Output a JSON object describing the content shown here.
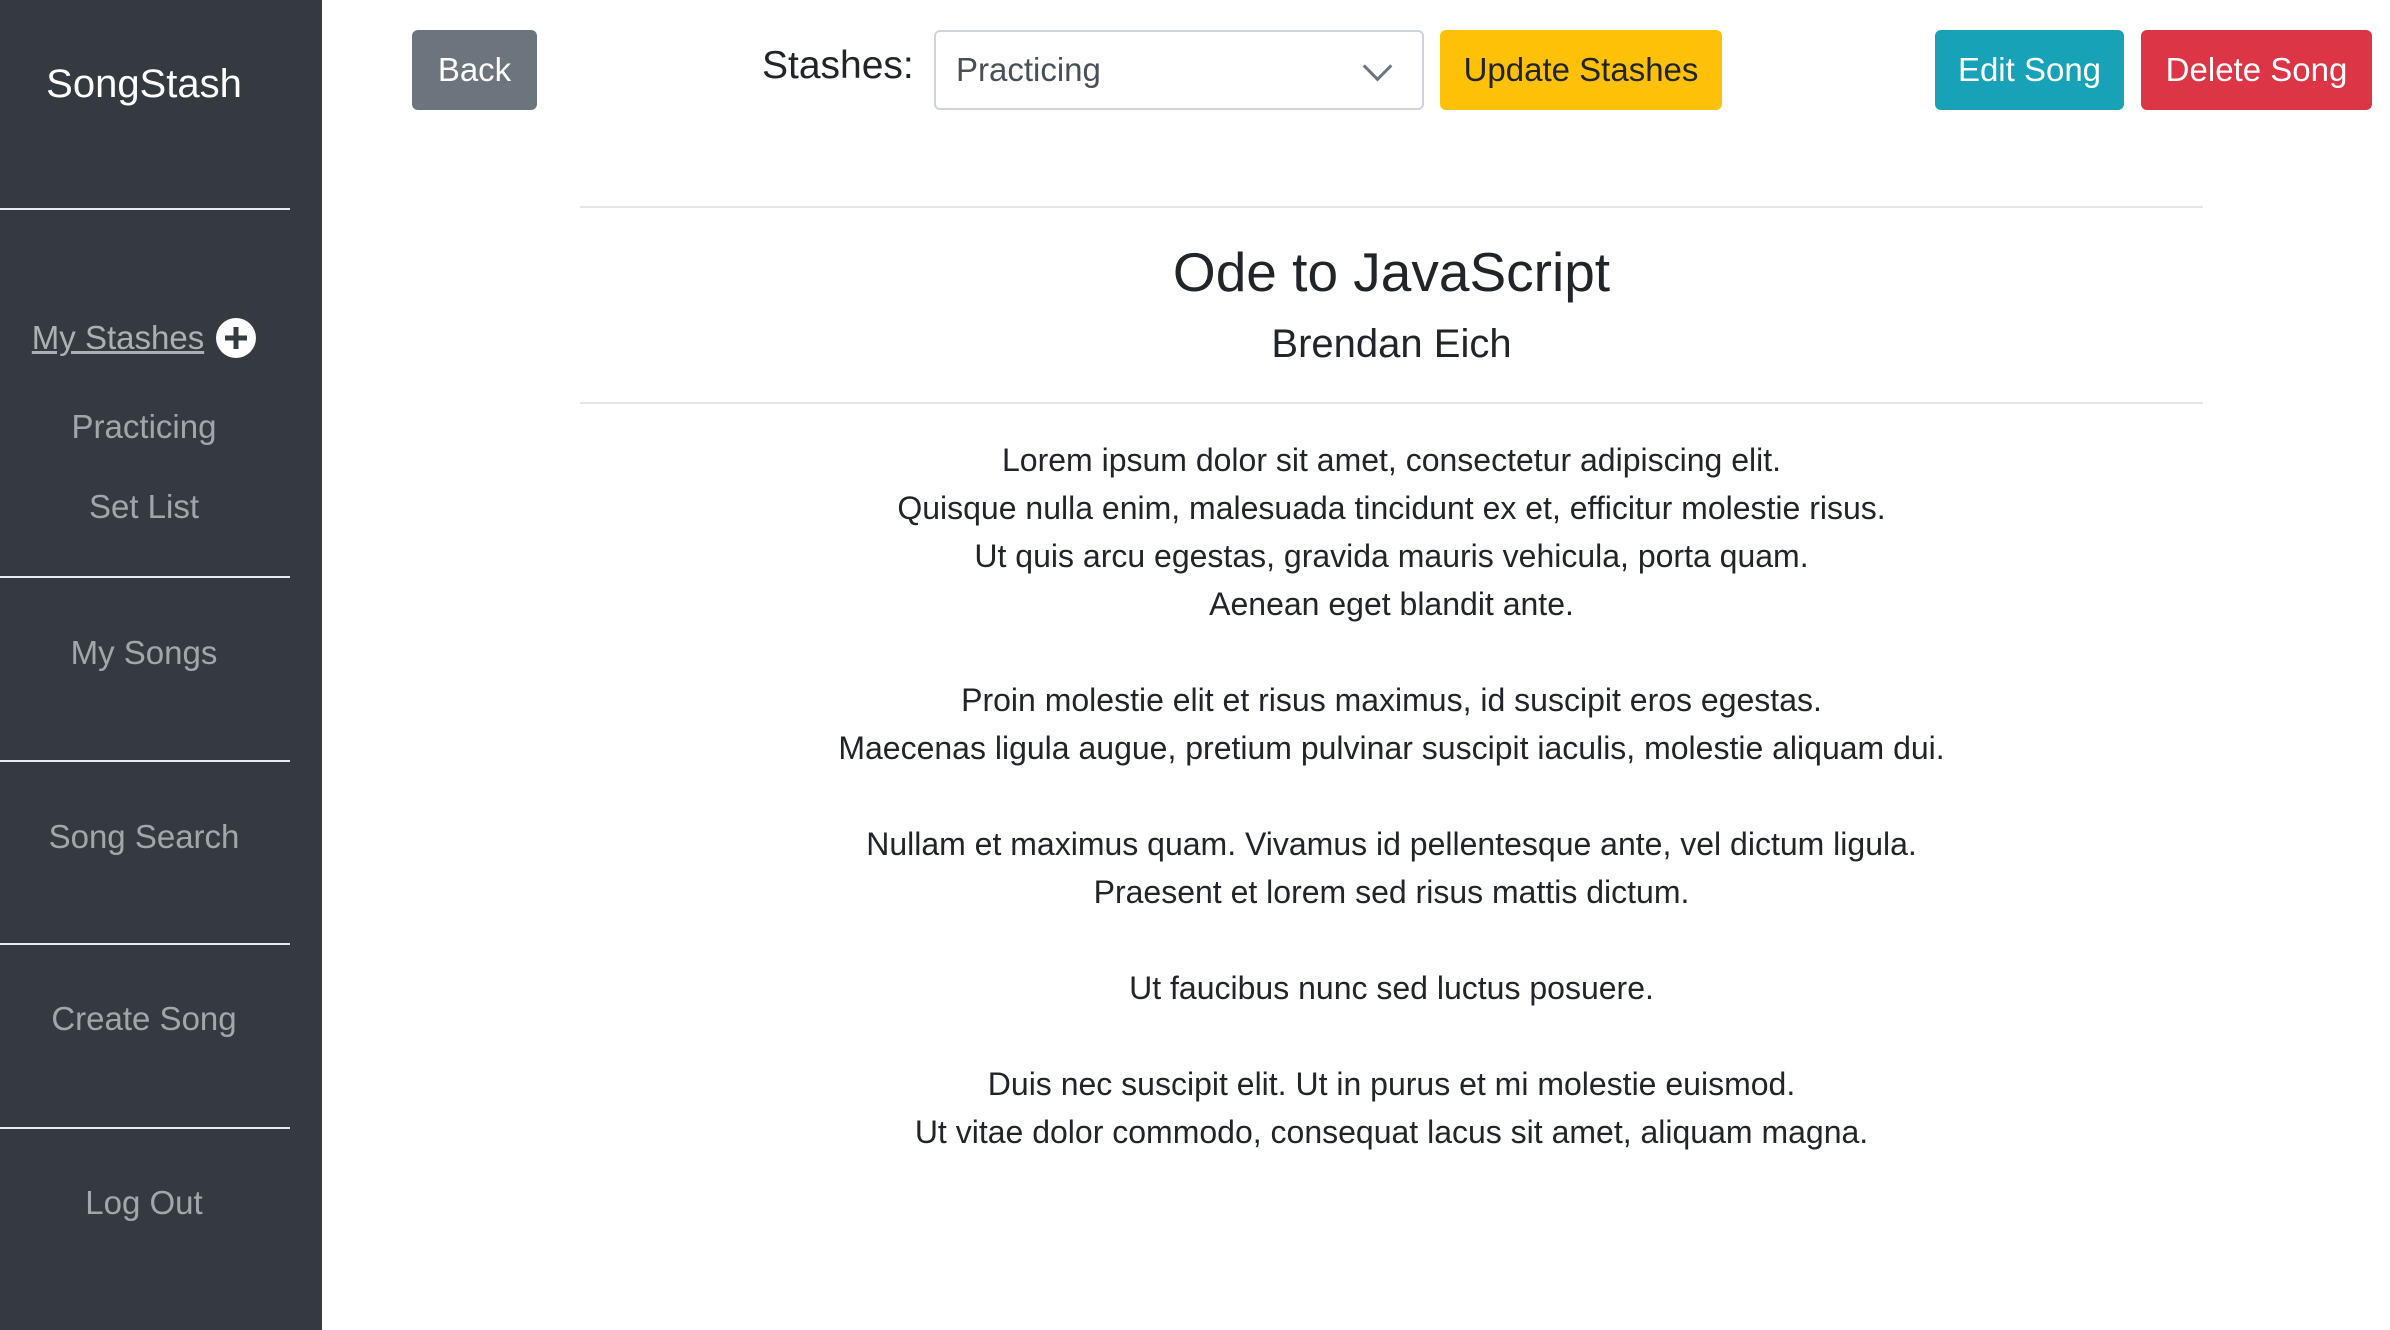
{
  "sidebar": {
    "brand": "SongStash",
    "my_stashes_label": "My Stashes",
    "stashes": [
      {
        "label": "Practicing"
      },
      {
        "label": "Set List"
      }
    ],
    "my_songs": "My Songs",
    "song_search": "Song Search",
    "create_song": "Create Song",
    "log_out": "Log Out",
    "add_icon": "plus-circle-icon"
  },
  "toolbar": {
    "back_label": "Back",
    "stashes_label": "Stashes:",
    "stash_select_value": "Practicing",
    "update_label": "Update Stashes",
    "edit_label": "Edit Song",
    "delete_label": "Delete Song"
  },
  "song": {
    "title": "Ode to JavaScript",
    "artist": "Brendan Eich",
    "stanzas": [
      [
        "Lorem ipsum dolor sit amet, consectetur adipiscing elit.",
        "Quisque nulla enim, malesuada tincidunt ex et, efficitur molestie risus.",
        "Ut quis arcu egestas, gravida mauris vehicula, porta quam.",
        "Aenean eget blandit ante."
      ],
      [
        "Proin molestie elit et risus maximus, id suscipit eros egestas.",
        "Maecenas ligula augue, pretium pulvinar suscipit iaculis, molestie aliquam dui."
      ],
      [
        "Nullam et maximus quam. Vivamus id pellentesque ante, vel dictum ligula.",
        "Praesent et lorem sed risus mattis dictum."
      ],
      [
        "Ut faucibus nunc sed luctus posuere."
      ],
      [
        "Duis nec suscipit elit. Ut in purus et mi molestie euismod.",
        "Ut vitae dolor commodo, consequat lacus sit amet, aliquam magna."
      ]
    ]
  },
  "colors": {
    "sidebar_bg": "#343a40",
    "back_button": "#6c757d",
    "update_button": "#ffc107",
    "edit_button": "#17a2b8",
    "delete_button": "#dc3545"
  }
}
